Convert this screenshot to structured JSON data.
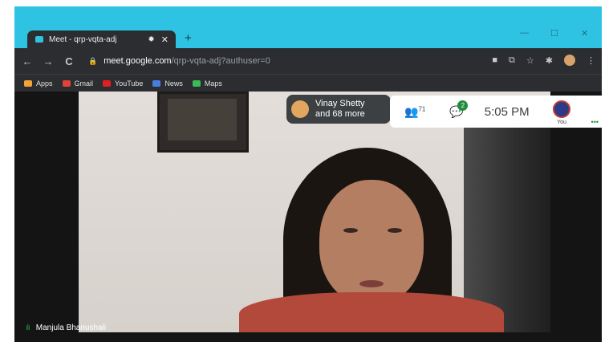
{
  "browser": {
    "tab_title": "Meet - qrp-vqta-adj",
    "url_host": "meet.google.com",
    "url_path": "/qrp-vqta-adj?authuser=0",
    "icons": {
      "back": "←",
      "forward": "→",
      "reload": "C",
      "lock": "🔒",
      "camera": "■",
      "translate": "⧉",
      "star": "☆",
      "extensions": "✱",
      "menu": "⋮",
      "audio": "✹",
      "close": "✕",
      "newtab": "+",
      "minimize": "—",
      "maximize": "☐",
      "window_close": "✕"
    }
  },
  "bookmarks": [
    {
      "label": "Apps",
      "color": "#f2a33a"
    },
    {
      "label": "Gmail",
      "color": "#e04337"
    },
    {
      "label": "YouTube",
      "color": "#e02020"
    },
    {
      "label": "News",
      "color": "#4a7de0"
    },
    {
      "label": "Maps",
      "color": "#3cba54"
    }
  ],
  "meet": {
    "participant_pill": {
      "line1": "Vinay Shetty",
      "line2": "and 68 more"
    },
    "people_icon": "👥",
    "people_count": "71",
    "chat_icon": "💬",
    "chat_badge": "2",
    "time": "5:05 PM",
    "self_label": "You",
    "more_dots": "•••",
    "speaker_name": "Manjula Bhanushali",
    "mic_icon": "ılı"
  }
}
